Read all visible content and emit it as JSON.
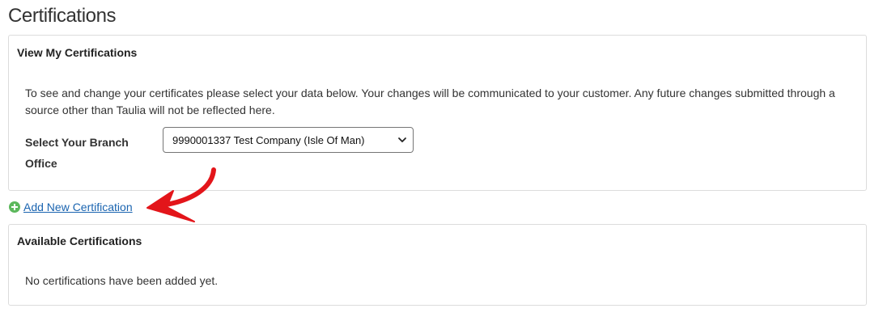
{
  "page": {
    "title": "Certifications"
  },
  "view_panel": {
    "heading": "View My Certifications",
    "intro": "To see and change your certificates please select your data below. Your changes will be communicated to your customer. Any future changes submitted through a source other than Taulia will not be reflected here.",
    "branch_label": "Select Your Branch Office",
    "branch_selected": "9990001337 Test Company (Isle Of Man)"
  },
  "actions": {
    "add_new_label": "Add New Certification"
  },
  "available_panel": {
    "heading": "Available Certifications",
    "empty_message": "No certifications have been added yet."
  },
  "colors": {
    "link": "#1a64b0",
    "add_icon": "#5cb85c",
    "annotation_arrow": "#e3151a"
  },
  "icons": [
    "plus-circle-icon",
    "chevron-down-icon",
    "annotation-arrow-icon"
  ]
}
